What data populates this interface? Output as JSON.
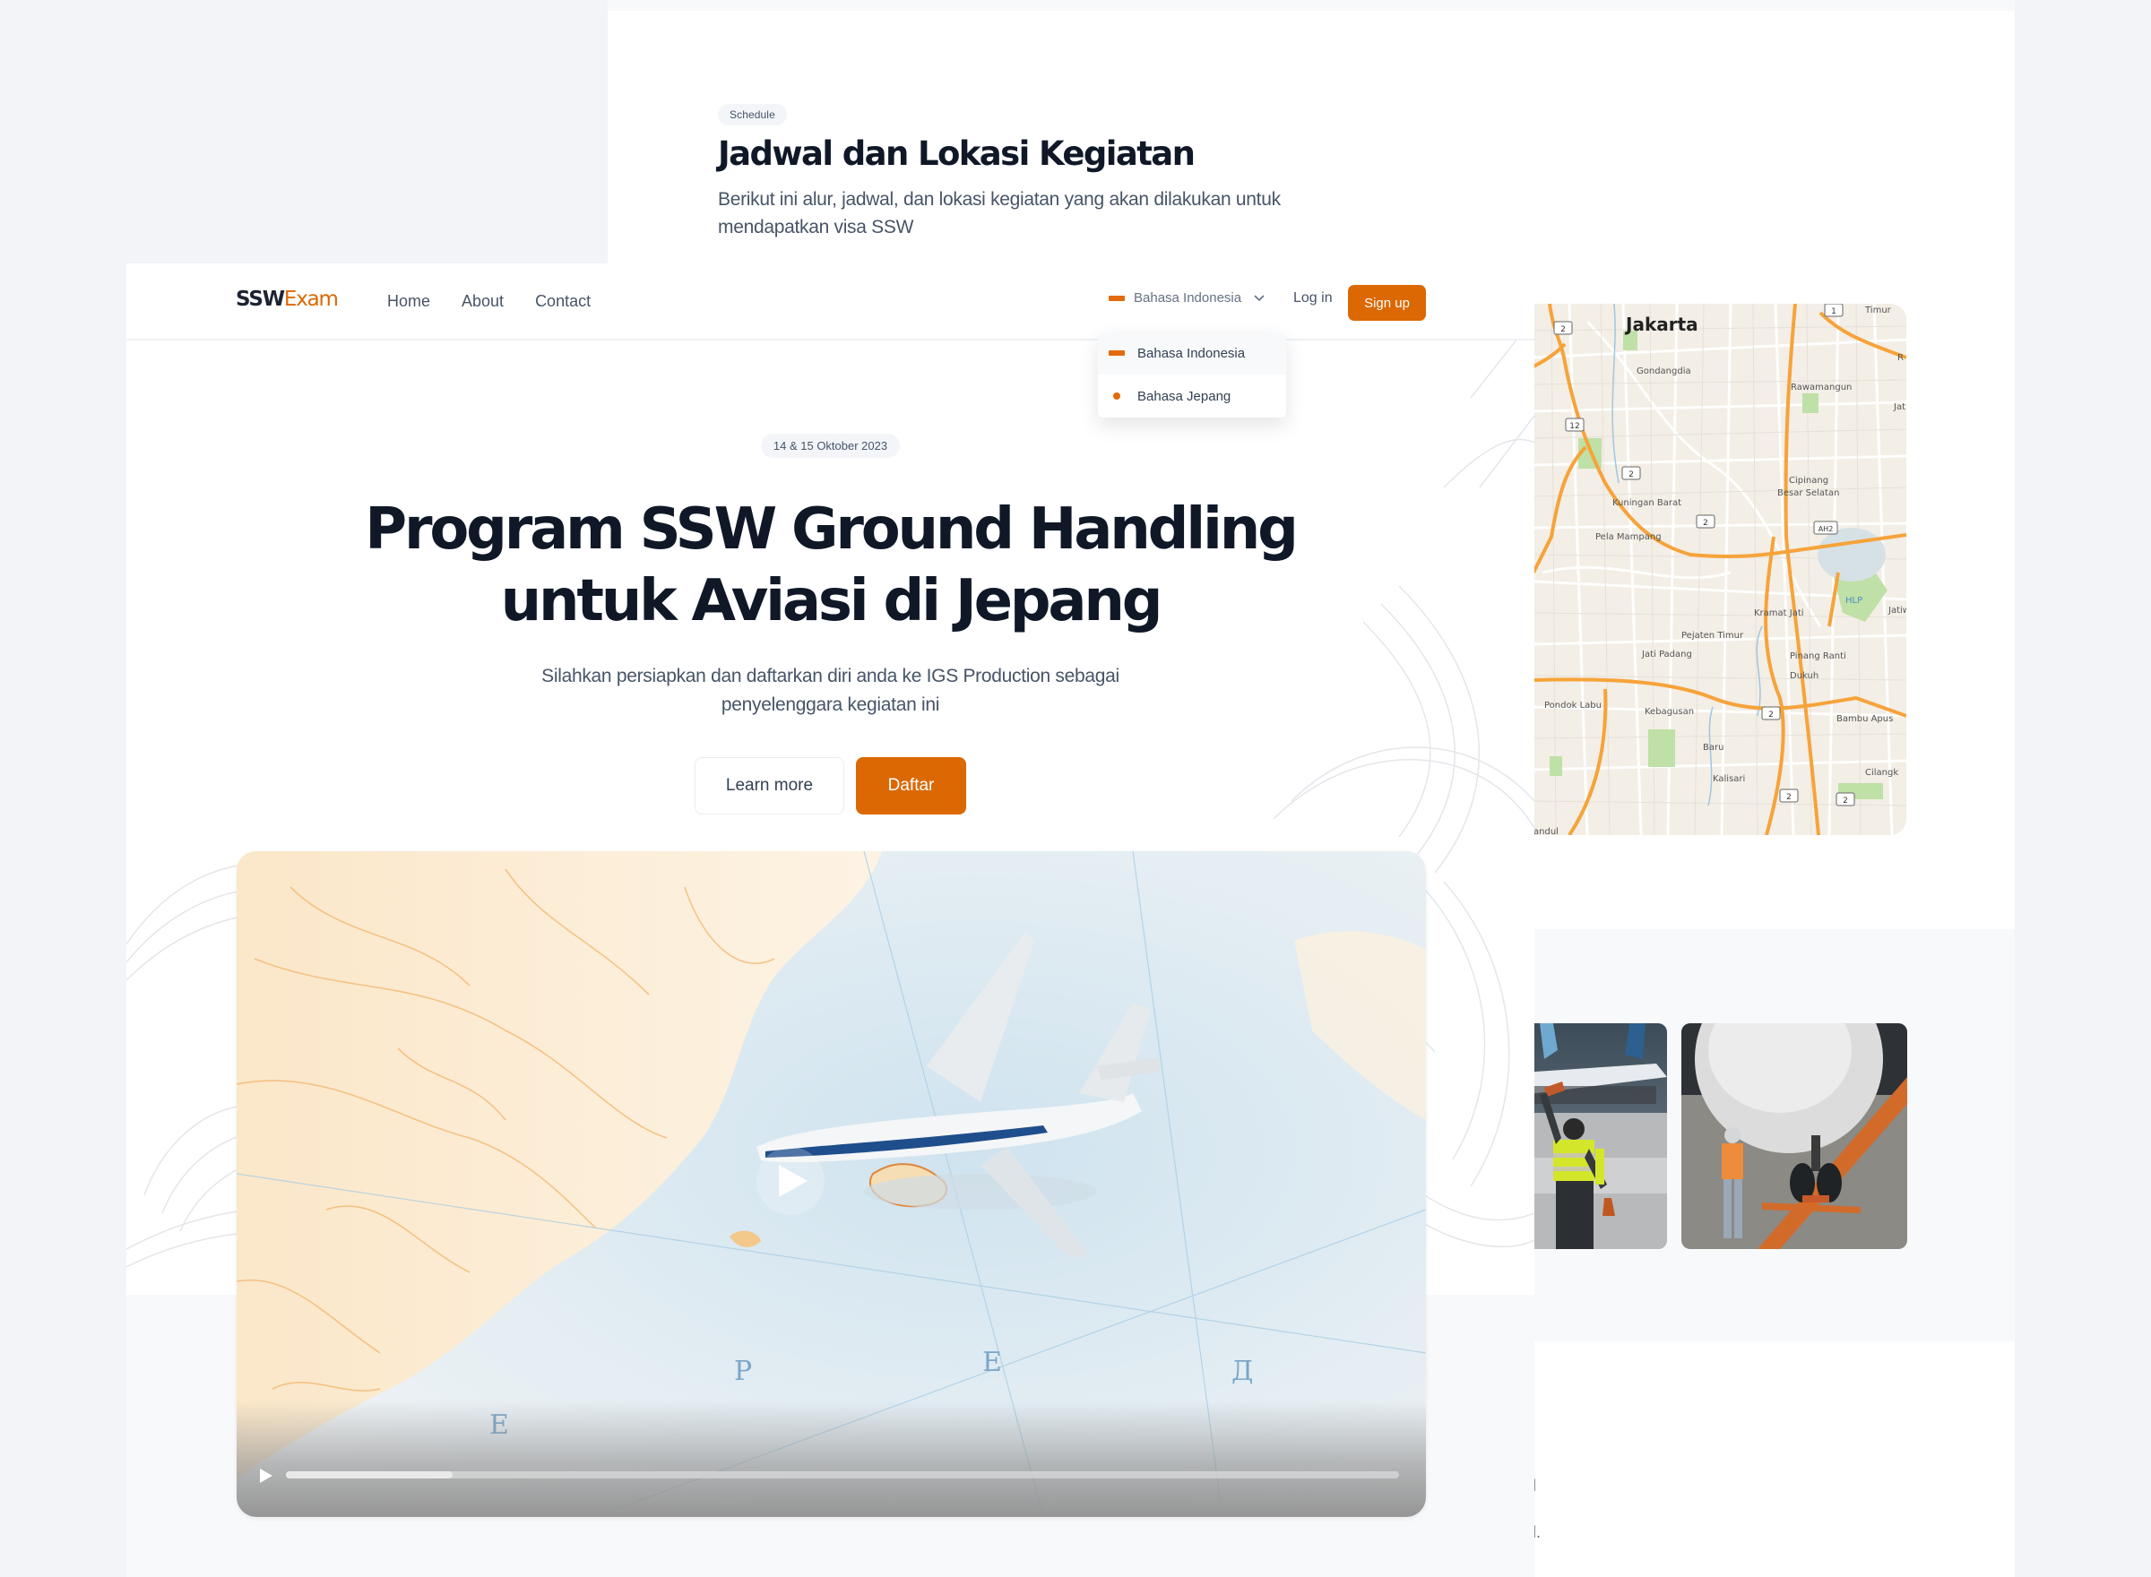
{
  "schedule": {
    "badge": "Schedule",
    "title": "Jadwal dan Lokasi Kegiatan",
    "description_line1": "Berikut ini alur, jadwal, dan lokasi kegiatan yang akan dilakukan untuk",
    "description_line2": "mendapatkan visa SSW"
  },
  "map": {
    "city": "Jakarta",
    "labels": {
      "gondangdia": "Gondangdia",
      "rawamangun": "Rawamangun",
      "kuningan_barat": "Kuningan Barat",
      "pela_mampang": "Pela Mampang",
      "cipinang1": "Cipinang",
      "cipinang2": "Besar Selatan",
      "kramat_jati": "Kramat Jati",
      "pejaten_timur": "Pejaten Timur",
      "jati_padang": "Jati Padang",
      "pinang_ranti": "Pinang Ranti",
      "dukuh": "Dukuh",
      "pondok_labu": "Pondok Labu",
      "kebagusan": "Kebagusan",
      "bambu_apus": "Bambu Apus",
      "baru": "Baru",
      "kalisari": "Kalisari",
      "cilangkap": "Cilangk",
      "timur": "Timur",
      "hlp": "HLP",
      "sandul": "andul",
      "jatiw": "Jatiw",
      "ja": "Jat",
      "r": "R"
    },
    "shields": {
      "r2": "2",
      "r1": "1",
      "r12": "12",
      "ah2": "AH2"
    }
  },
  "nav": {
    "logo_part1": "SSW",
    "logo_part2": "Exam",
    "links": [
      "Home",
      "About",
      "Contact"
    ],
    "language_selected": "Bahasa Indonesia",
    "login": "Log in",
    "signup": "Sign up",
    "language_options": [
      {
        "label": "Bahasa Indonesia",
        "active": true
      },
      {
        "label": "Bahasa Jepang",
        "active": false
      }
    ]
  },
  "hero": {
    "date_badge": "14 & 15 Oktober 2023",
    "title_line1": "Program SSW Ground Handling",
    "title_line2": "untuk Aviasi di Jepang",
    "subtitle_line1": "Silahkan persiapkan dan daftarkan diri anda ke IGS Production sebagai",
    "subtitle_line2": "penyelenggara kegiatan ini",
    "learn_more": "Learn more",
    "register": "Daftar"
  },
  "video": {
    "progress_percent": 15,
    "map_letters": [
      "P",
      "E",
      "Д",
      "E"
    ]
  },
  "fragments": {
    "a": "l",
    "b": "l."
  },
  "colors": {
    "accent": "#dc6803",
    "heading": "#101828",
    "body": "#475467"
  }
}
